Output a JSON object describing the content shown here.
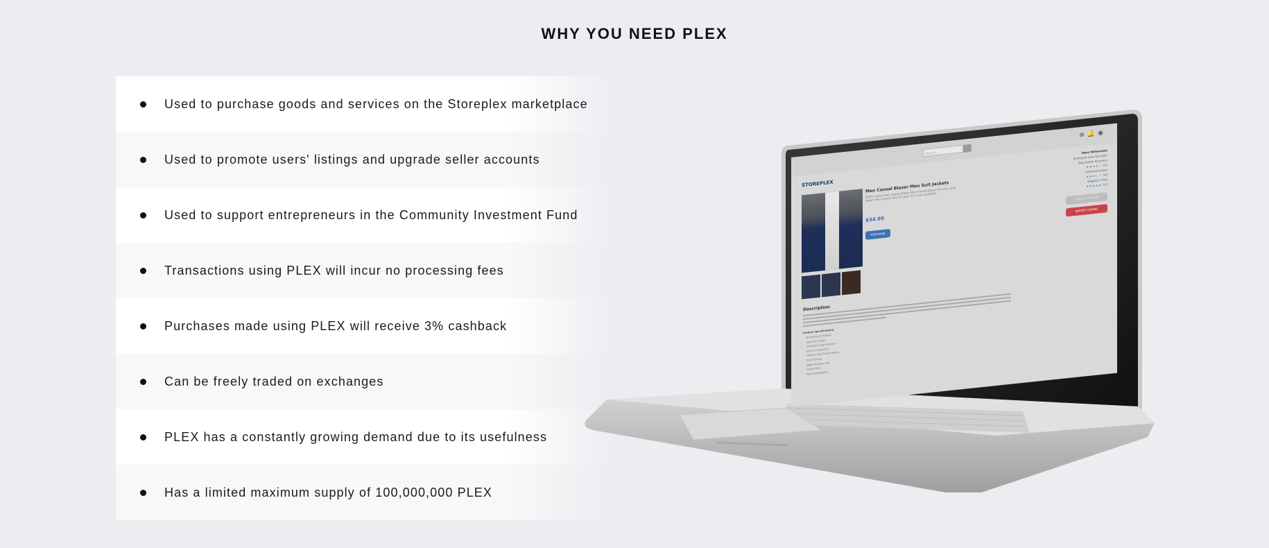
{
  "title": "WHY YOU NEED PLEX",
  "benefits": [
    "Used to purchase goods and services on the Storeplex marketplace",
    "Used to promote users' listings and upgrade seller accounts",
    "Used to support entrepreneurs in the Community Investment Fund",
    "Transactions using PLEX will incur no processing fees",
    "Purchases made using PLEX will receive 3% cashback",
    "Can be freely traded on exchanges",
    "PLEX has a constantly growing demand due to its usefulness",
    "Has a limited maximum supply of 100,000,000 PLEX"
  ],
  "laptop_screen": {
    "logo": "STOREPLEX",
    "search_placeholder": "Search...",
    "product_title": "Men Casual Blazer Men Suit Jackets",
    "product_subtitle": "100% Cotton Men Casual Blazer Men Formal Blazer for men solid Smart Men Jackets Slim Fit Size: S-5 color available",
    "price": "$34.99",
    "purchase_button": "PURCHASE",
    "seller_name": "Mass Millennials",
    "seller_since": "Selling for over one year",
    "rating_labels": [
      "Description Accuracy",
      "Communication",
      "Dispatch Time"
    ],
    "ratings": [
      "4.5",
      "3.0",
      "5.0"
    ],
    "contact_button": "CONTACT SELLER",
    "report_button": "REPORT LISTING",
    "description_heading": "Description",
    "specs_heading": "Product specifications:",
    "specs": [
      "Brand Name:Hudson",
      "Material:Cotton",
      "Clothing Length:Regular",
      "Sleeve Length:Full",
      "Closure Type:Single Button",
      "Style:Formal",
      "Model Number:LWL",
      "Gender:Men",
      "Pant Type:Blazers"
    ]
  },
  "colors": {
    "background": "#ecedf1",
    "accent_blue": "#3f72b5",
    "report_red": "#c9444a"
  }
}
